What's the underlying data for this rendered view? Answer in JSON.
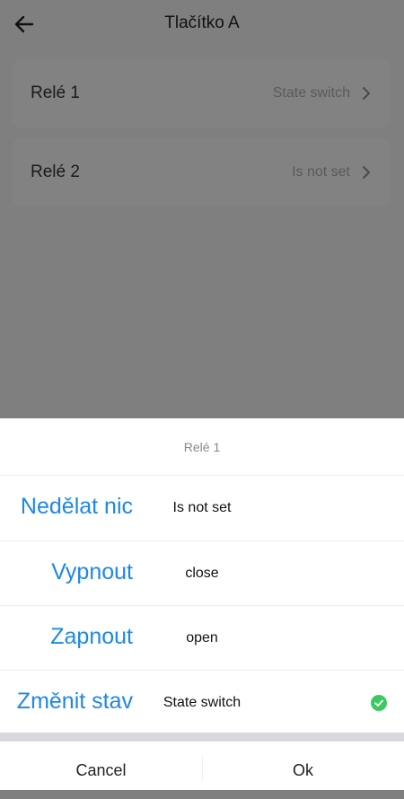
{
  "header": {
    "title": "Tlačítko A"
  },
  "cards": [
    {
      "label": "Relé 1",
      "value": "State switch"
    },
    {
      "label": "Relé 2",
      "value": "Is not set"
    }
  ],
  "sheet": {
    "title": "Relé 1",
    "options": [
      {
        "czech": "Nedělat nic",
        "name": "Is not set"
      },
      {
        "czech": "Vypnout",
        "name": "close"
      },
      {
        "czech": "Zapnout",
        "name": "open"
      },
      {
        "czech": "Změnit stav",
        "name": "State switch",
        "selected": true
      }
    ],
    "cancel_label": "Cancel",
    "ok_label": "Ok"
  },
  "colors": {
    "accent": "#1e88e5",
    "check": "#3cc862",
    "overlay": "#7f7f7f"
  }
}
